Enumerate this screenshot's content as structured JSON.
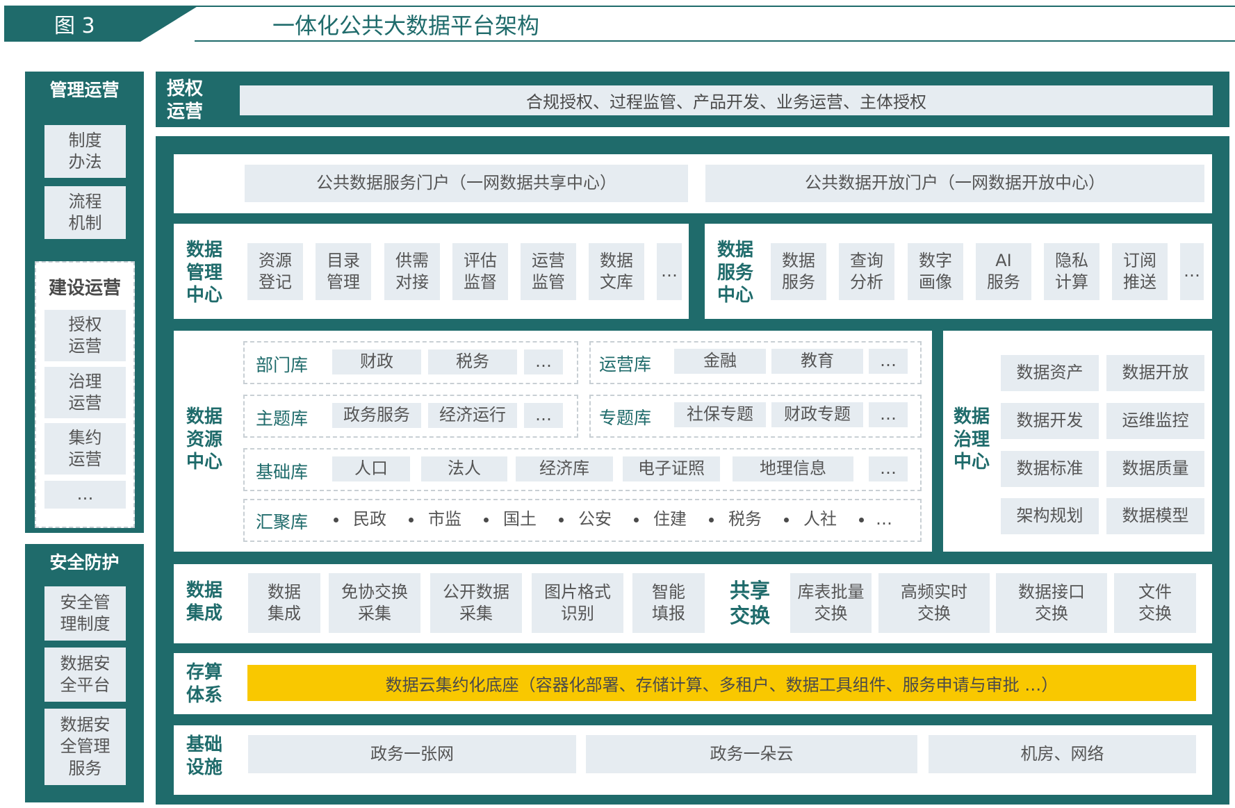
{
  "header": {
    "number": "图 3",
    "title": "一体化公共大数据平台架构"
  },
  "left": {
    "mgmt_title": "管理运营",
    "mgmt_items": [
      "制度\n办法",
      "流程\n机制"
    ],
    "build_title": "建设运营",
    "build_items": [
      "授权\n运营",
      "治理\n运营",
      "集约\n运营",
      "…"
    ],
    "sec_title": "安全防护",
    "sec_items": [
      "安全管\n理制度",
      "数据安\n全平台",
      "数据安\n全管理\n服务"
    ]
  },
  "auth": {
    "label": "授权\n运营",
    "content": "合规授权、过程监管、产品开发、业务运营、主体授权"
  },
  "portals": [
    "公共数据服务门户（一网数据共享中心）",
    "公共数据开放门户（一网数据开放中心）"
  ],
  "data_mgmt": {
    "label": "数据\n管理\n中心",
    "items": [
      "资源\n登记",
      "目录\n管理",
      "供需\n对接",
      "评估\n监督",
      "运营\n监管",
      "数据\n文库",
      "…"
    ]
  },
  "data_service": {
    "label": "数据\n服务\n中心",
    "items": [
      "数据\n服务",
      "查询\n分析",
      "数字\n画像",
      "AI\n服务",
      "隐私\n计算",
      "订阅\n推送",
      "…"
    ]
  },
  "data_resource": {
    "label": "数据\n资源\n中心",
    "dept": {
      "name": "部门库",
      "items": [
        "财政",
        "税务",
        "…"
      ]
    },
    "ops": {
      "name": "运营库",
      "items": [
        "金融",
        "教育",
        "…"
      ]
    },
    "topic": {
      "name": "主题库",
      "items": [
        "政务服务",
        "经济运行",
        "…"
      ]
    },
    "special": {
      "name": "专题库",
      "items": [
        "社保专题",
        "财政专题",
        "…"
      ]
    },
    "base": {
      "name": "基础库",
      "items": [
        "人口",
        "法人",
        "经济库",
        "电子证照",
        "地理信息",
        "…"
      ]
    },
    "agg": {
      "name": "汇聚库",
      "items": [
        "民政",
        "市监",
        "国土",
        "公安",
        "住建",
        "税务",
        "人社",
        "…"
      ]
    }
  },
  "data_gov": {
    "label": "数据\n治理\n中心",
    "items": [
      "数据资产",
      "数据开放",
      "数据开发",
      "运维监控",
      "数据标准",
      "数据质量",
      "架构规划",
      "数据模型"
    ]
  },
  "integration": {
    "label": "数据\n集成",
    "items": [
      "数据\n集成",
      "免协交换\n采集",
      "公开数据\n采集",
      "图片格式\n识别",
      "智能\n填报"
    ],
    "share_label": "共享\n交换",
    "share_items": [
      "库表批量\n交换",
      "高频实时\n交换",
      "数据接口\n交换",
      "文件\n交换"
    ]
  },
  "compute": {
    "label": "存算\n体系",
    "content": "数据云集约化底座（容器化部署、存储计算、多租户、数据工具组件、服务申请与审批 …）"
  },
  "infra": {
    "label": "基础\n设施",
    "items": [
      "政务一张网",
      "政务一朵云",
      "机房、网络"
    ]
  },
  "colors": {
    "teal": "#1f6b6b",
    "box_grey": "#e6ecf1",
    "highlight": "#f9c800"
  }
}
